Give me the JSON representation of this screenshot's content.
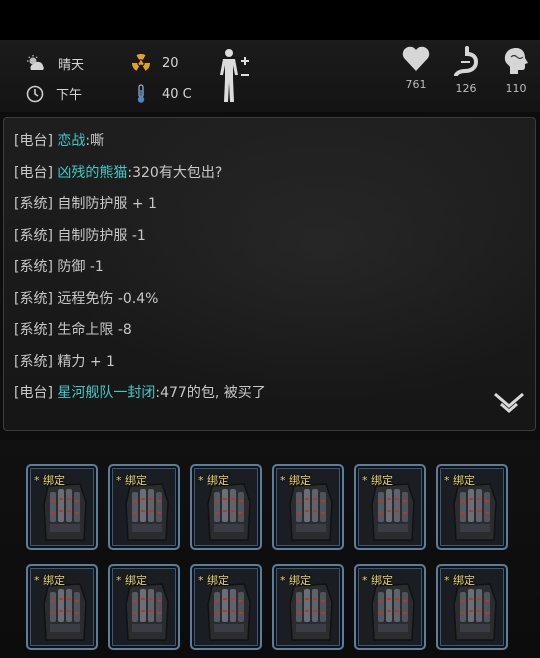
{
  "status": {
    "weather": {
      "icon": "cloud-sun-icon",
      "label": "晴天"
    },
    "time": {
      "icon": "clock-icon",
      "label": "下午"
    },
    "radiation": {
      "icon": "radiation-icon",
      "value": "20"
    },
    "temperature": {
      "icon": "thermometer-icon",
      "value": "40 C"
    },
    "body": {
      "icon": "body-figure-icon"
    },
    "vitals": [
      {
        "icon": "heart-icon",
        "value": "761"
      },
      {
        "icon": "stomach-icon",
        "value": "126"
      },
      {
        "icon": "brain-icon",
        "value": "110"
      }
    ]
  },
  "chat": {
    "messages": [
      {
        "channel": "[电台]",
        "name": "恋战",
        "text": ":嘶"
      },
      {
        "channel": "[电台]",
        "name": "凶残的熊猫",
        "text": ":320有大包出?"
      },
      {
        "channel": "[系统]",
        "name": "",
        "text": "自制防护服 + 1"
      },
      {
        "channel": "[系统]",
        "name": "",
        "text": "自制防护服 -1"
      },
      {
        "channel": "[系统]",
        "name": "",
        "text": "防御 -1"
      },
      {
        "channel": "[系统]",
        "name": "",
        "text": "远程免伤 -0.4%"
      },
      {
        "channel": "[系统]",
        "name": "",
        "text": "生命上限 -8"
      },
      {
        "channel": "[系统]",
        "name": "",
        "text": "精力 + 1"
      },
      {
        "channel": "[电台]",
        "name": "星河舰队一封闭",
        "text": ":477的包, 被买了"
      }
    ]
  },
  "inventory": {
    "slots": [
      {
        "tag": "* 绑定",
        "icon": "armored-glove-icon"
      },
      {
        "tag": "* 绑定",
        "icon": "armored-glove-icon"
      },
      {
        "tag": "* 绑定",
        "icon": "armored-glove-icon"
      },
      {
        "tag": "* 绑定",
        "icon": "armored-glove-icon"
      },
      {
        "tag": "* 绑定",
        "icon": "armored-glove-icon"
      },
      {
        "tag": "* 绑定",
        "icon": "armored-glove-icon"
      },
      {
        "tag": "* 绑定",
        "icon": "armored-glove-icon"
      },
      {
        "tag": "* 绑定",
        "icon": "armored-glove-icon"
      },
      {
        "tag": "* 绑定",
        "icon": "armored-glove-icon"
      },
      {
        "tag": "* 绑定",
        "icon": "armored-glove-icon"
      },
      {
        "tag": "* 绑定",
        "icon": "armored-glove-icon"
      },
      {
        "tag": "* 绑定",
        "icon": "armored-glove-icon"
      }
    ]
  },
  "colors": {
    "player_name": "#3ec8c8",
    "bound_tag": "#e8d36a",
    "slot_border": "#5c7d9c"
  }
}
